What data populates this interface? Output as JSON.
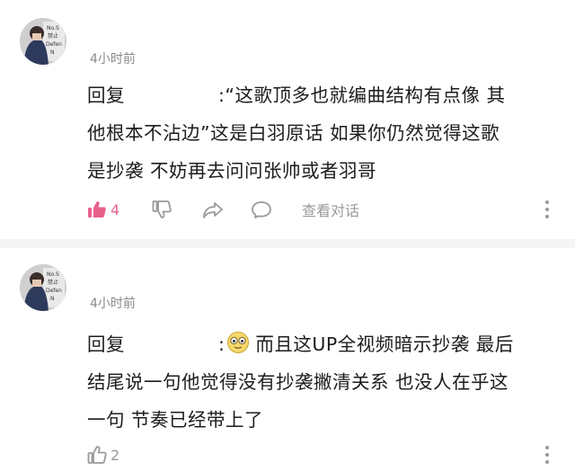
{
  "comments": [
    {
      "time": "4小时前",
      "reply_label": "回复",
      "lines": [
        ":“这歌顶多也就编曲结构有点像 其",
        "他根本不沾边”这是白羽原话 如果你仍然觉得这歌",
        "是抄袭 不妨再去问问张帅或者羽哥"
      ],
      "likes": "4",
      "view_dialog": "查看对话",
      "liked": true,
      "avatar_text": [
        "No.S",
        "禁止",
        "Defen",
        "N"
      ]
    },
    {
      "time": "4小时前",
      "reply_label": "回复",
      "lines": [
        ":",
        "而且这UP全视频暗示抄袭 最后",
        "结尾说一句他觉得没有抄袭撇清关系 也没人在乎这",
        "一句 节奏已经带上了"
      ],
      "likes": "2",
      "liked": false,
      "avatar_text": [
        "No.S",
        "禁止",
        "Defen",
        "N"
      ]
    }
  ],
  "colors": {
    "accent": "#e8618c",
    "muted": "#9a9a9a"
  }
}
